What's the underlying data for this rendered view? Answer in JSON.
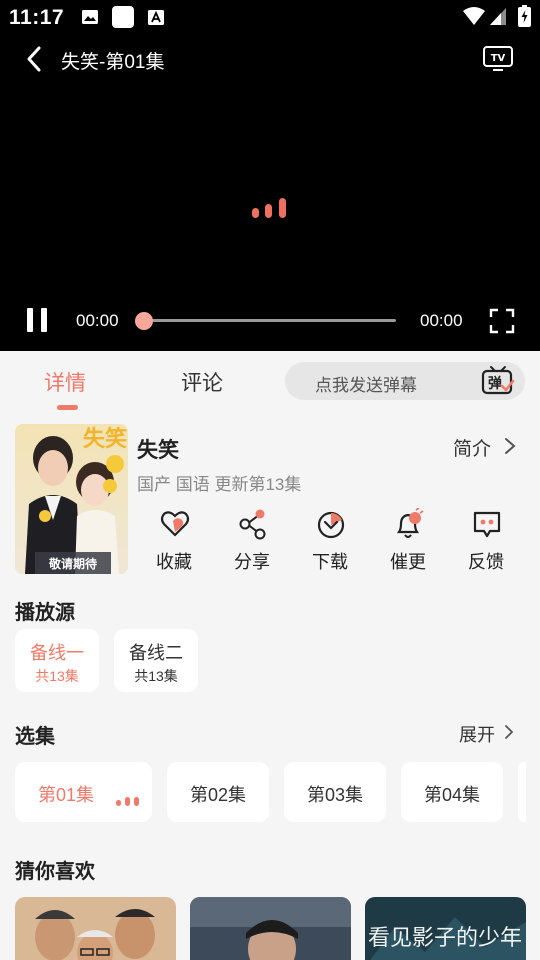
{
  "status_bar": {
    "time": "11:17"
  },
  "player": {
    "title": "失笑-第01集",
    "current_time": "00:00",
    "total_time": "00:00",
    "progress": 0,
    "loading_color": "#f07060"
  },
  "tabs": [
    {
      "label": "详情",
      "active": true
    },
    {
      "label": "评论",
      "active": false
    }
  ],
  "danmaku": {
    "placeholder": "点我发送弹幕",
    "icon_text": "弹"
  },
  "show": {
    "title": "失笑",
    "meta": "国产 国语 更新第13集",
    "intro_label": "简介",
    "poster_title": "失笑",
    "poster_text": "敬请期待"
  },
  "actions": [
    {
      "label": "收藏",
      "icon": "heart-icon"
    },
    {
      "label": "分享",
      "icon": "share-icon"
    },
    {
      "label": "下载",
      "icon": "download-icon"
    },
    {
      "label": "催更",
      "icon": "bell-icon"
    },
    {
      "label": "反馈",
      "icon": "feedback-icon"
    }
  ],
  "sources_section": {
    "title": "播放源",
    "items": [
      {
        "name": "备线一",
        "count": "共13集",
        "active": true
      },
      {
        "name": "备线二",
        "count": "共13集",
        "active": false
      }
    ]
  },
  "episodes_section": {
    "title": "选集",
    "expand_label": "展开",
    "items": [
      {
        "label": "第01集",
        "active": true
      },
      {
        "label": "第02集",
        "active": false
      },
      {
        "label": "第03集",
        "active": false
      },
      {
        "label": "第04集",
        "active": false
      }
    ]
  },
  "recommend_section": {
    "title": "猜你喜欢",
    "poster_3_text": "看见影子的少年"
  },
  "colors": {
    "accent": "#f07a6a",
    "background": "#f5f5f5",
    "player_bg": "#000000"
  }
}
